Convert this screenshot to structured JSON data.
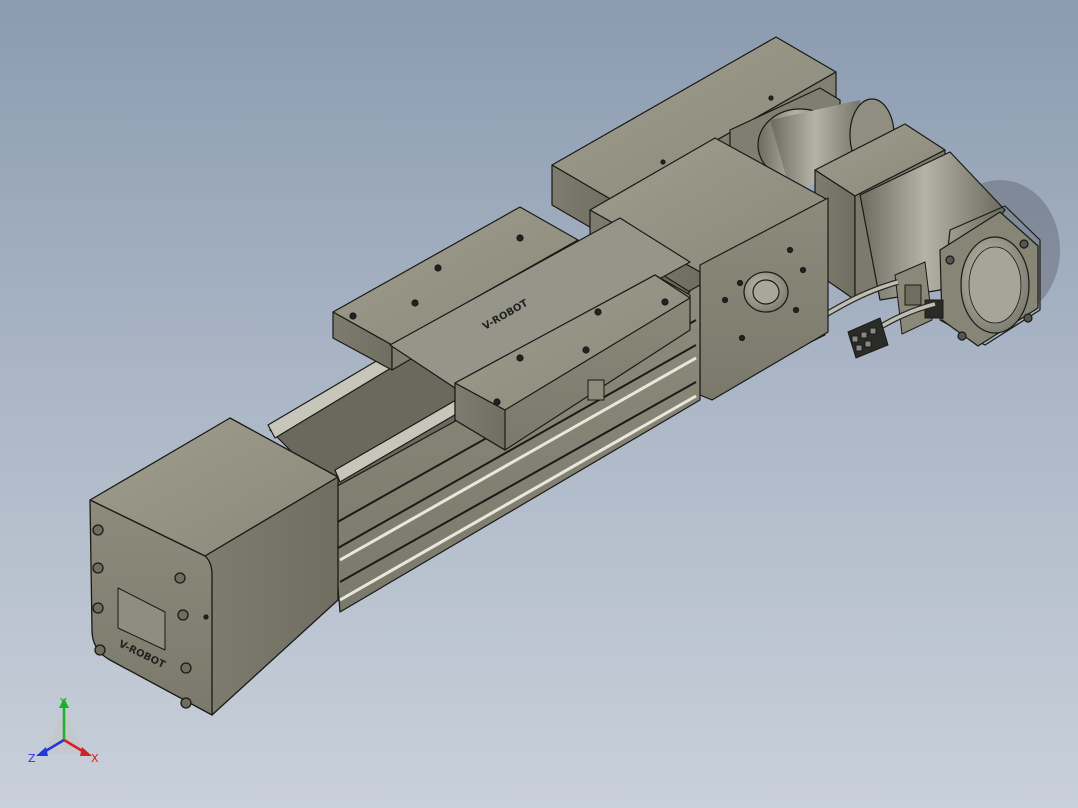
{
  "viewport": {
    "background_top": "#8b9bb0",
    "background_bottom": "#c9d0da",
    "model_color": "#8d8c7d",
    "model_edge_color": "#1a1a16"
  },
  "model": {
    "name": "",
    "carriage_logo": "V-ROBOT",
    "end_cap_logo": "V-ROBOT"
  },
  "triad": {
    "x_label": "X",
    "y_label": "Y",
    "z_label": "Z",
    "x_color": "#d42020",
    "y_color": "#1fb02a",
    "z_color": "#2436d8"
  }
}
